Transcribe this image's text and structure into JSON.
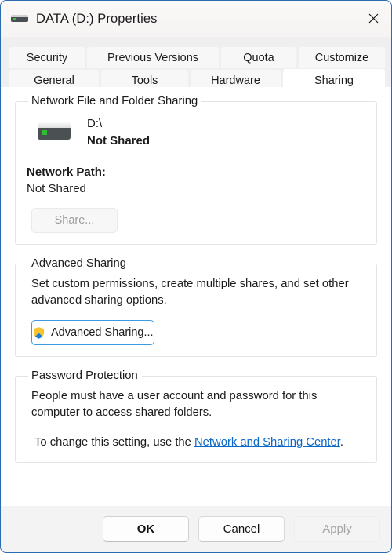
{
  "window": {
    "title": "DATA (D:) Properties",
    "icon": "hard-drive-icon",
    "close_label": "✕",
    "border_color": "#2b6cb0"
  },
  "tabs": {
    "row1": [
      {
        "label": "Security",
        "active": false
      },
      {
        "label": "Previous Versions",
        "active": false
      },
      {
        "label": "Quota",
        "active": false
      },
      {
        "label": "Customize",
        "active": false
      }
    ],
    "row2": [
      {
        "label": "General",
        "active": false
      },
      {
        "label": "Tools",
        "active": false
      },
      {
        "label": "Hardware",
        "active": false
      },
      {
        "label": "Sharing",
        "active": true
      }
    ]
  },
  "network_sharing": {
    "legend": "Network File and Folder Sharing",
    "drive_name": "D:\\",
    "share_state": "Not Shared",
    "network_path_label": "Network Path:",
    "network_path_value": "Not Shared",
    "share_button": "Share...",
    "share_button_enabled": false
  },
  "advanced_sharing": {
    "legend": "Advanced Sharing",
    "description": "Set custom permissions, create multiple shares, and set other advanced sharing options.",
    "button_label": "Advanced Sharing...",
    "button_icon": "uac-shield-icon",
    "focus_color": "#3c9ae0"
  },
  "password_protection": {
    "legend": "Password Protection",
    "description": "People must have a user account and password for this computer to access shared folders.",
    "hint_prefix": "To change this setting, use the ",
    "link_text": "Network and Sharing Center",
    "hint_suffix": ".",
    "link_color": "#0a68c8"
  },
  "footer": {
    "ok": "OK",
    "cancel": "Cancel",
    "apply": "Apply",
    "apply_enabled": false
  }
}
